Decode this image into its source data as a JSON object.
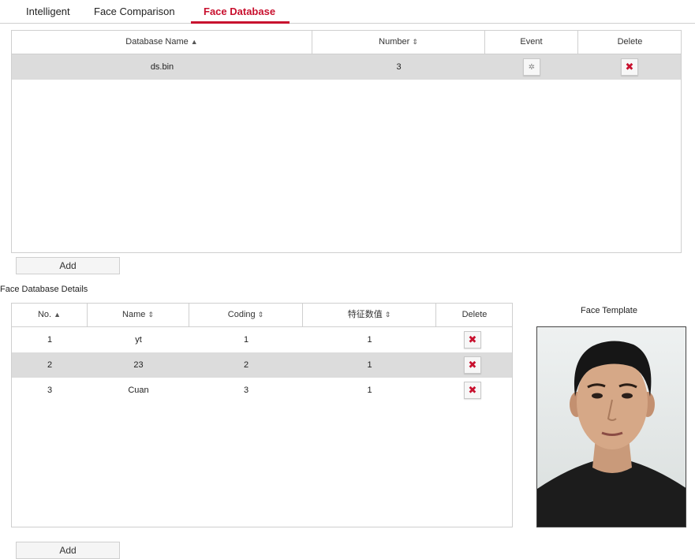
{
  "tabs": [
    "Intelligent",
    "Face Comparison",
    "Face Database"
  ],
  "db_table": {
    "headers": {
      "name": "Database Name",
      "number": "Number",
      "event": "Event",
      "delete": "Delete"
    },
    "rows": [
      {
        "name": "ds.bin",
        "number": "3"
      }
    ]
  },
  "add_label": "Add",
  "details": {
    "title": "Face Database Details",
    "headers": {
      "no": "No.",
      "name": "Name",
      "coding": "Coding",
      "feature": "特征数值",
      "delete": "Delete"
    },
    "rows": [
      {
        "no": "1",
        "name": "yt",
        "coding": "1",
        "feature": "1"
      },
      {
        "no": "2",
        "name": "23",
        "coding": "2",
        "feature": "1"
      },
      {
        "no": "3",
        "name": "Cuan",
        "coding": "3",
        "feature": "1"
      }
    ]
  },
  "face_template_label": "Face Template",
  "icons": {
    "sort_asc": "▲",
    "sort_both": "⇕",
    "delete": "✖",
    "gear": "✲"
  },
  "colors": {
    "accent": "#c8102e",
    "row_highlight": "#dcdcdc"
  }
}
